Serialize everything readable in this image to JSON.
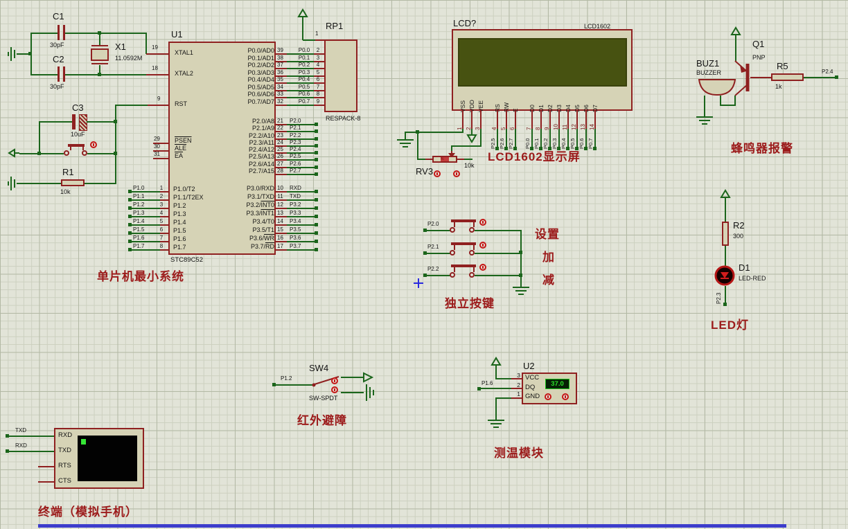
{
  "annotations": {
    "mcu": "单片机最小系统",
    "lcd": "LCD1602显示屏",
    "buzzer": "蜂鸣器报警",
    "keys_title": "独立按键",
    "key_set": "设置",
    "key_add": "加",
    "key_sub": "减",
    "led": "LED灯",
    "infrared": "红外避障",
    "temp": "测温模块",
    "terminal": "终端（模拟手机）"
  },
  "parts": {
    "c1": {
      "ref": "C1",
      "value": "30pF"
    },
    "c2": {
      "ref": "C2",
      "value": "30pF"
    },
    "x1": {
      "ref": "X1",
      "value": "11.0592M"
    },
    "c3": {
      "ref": "C3",
      "value": "10uF"
    },
    "r1": {
      "ref": "R1",
      "value": "10k"
    },
    "rv3": {
      "ref": "RV3",
      "value": "10k"
    },
    "rp1": {
      "ref": "RP1",
      "part": "RESPACK-8",
      "pin1_num": "1"
    },
    "r5": {
      "ref": "R5",
      "value": "1k"
    },
    "r2": {
      "ref": "R2",
      "value": "300"
    },
    "d1": {
      "ref": "D1",
      "part": "LED-RED"
    },
    "q1": {
      "ref": "Q1",
      "part": "PNP"
    },
    "buz1": {
      "ref": "BUZ1",
      "part": "BUZZER"
    },
    "sw4": {
      "ref": "SW4",
      "part": "SW-SPDT"
    },
    "u2": {
      "ref": "U2",
      "display_value": "37.0"
    },
    "lcd": {
      "ref": "LCD?",
      "part": "LCD1602"
    }
  },
  "nets": {
    "buzzer": "P2.4",
    "led": "P2.3",
    "sw": "P1.2",
    "temp": "P1.6"
  },
  "u1": {
    "ref": "U1",
    "part": "STC89C52",
    "xtal1": {
      "num": "19",
      "name": "XTAL1"
    },
    "xtal2": {
      "num": "18",
      "name": "XTAL2"
    },
    "rst": {
      "num": "9",
      "name": "RST"
    },
    "ctrl_pins": [
      {
        "num": "29",
        "pre": "",
        "over": "PSEN"
      },
      {
        "num": "30",
        "pre": "",
        "over": "ALE"
      },
      {
        "num": "31",
        "pre": "",
        "over": "EA"
      }
    ],
    "p0_pins": [
      {
        "num": "39",
        "pre": "P0.0/AD0",
        "over": "",
        "net": "P0.0",
        "rp_num": "2"
      },
      {
        "num": "38",
        "pre": "P0.1/AD1",
        "over": "",
        "net": "P0.1",
        "rp_num": "3"
      },
      {
        "num": "37",
        "pre": "P0.2/AD2",
        "over": "",
        "net": "P0.2",
        "rp_num": "4"
      },
      {
        "num": "36",
        "pre": "P0.3/AD3",
        "over": "",
        "net": "P0.3",
        "rp_num": "5"
      },
      {
        "num": "35",
        "pre": "P0.4/AD4",
        "over": "",
        "net": "P0.4",
        "rp_num": "6"
      },
      {
        "num": "34",
        "pre": "P0.5/AD5",
        "over": "",
        "net": "P0.5",
        "rp_num": "7"
      },
      {
        "num": "33",
        "pre": "P0.6/AD6",
        "over": "",
        "net": "P0.6",
        "rp_num": "8"
      },
      {
        "num": "32",
        "pre": "P0.7/AD7",
        "over": "",
        "net": "P0.7",
        "rp_num": "9"
      }
    ],
    "p2_pins": [
      {
        "num": "21",
        "pre": "P2.0/A8",
        "over": "",
        "net": "P2.0"
      },
      {
        "num": "22",
        "pre": "P2.1/A9",
        "over": "",
        "net": "P2.1"
      },
      {
        "num": "23",
        "pre": "P2.2/A10",
        "over": "",
        "net": "P2.2"
      },
      {
        "num": "24",
        "pre": "P2.3/A11",
        "over": "",
        "net": "P2.3"
      },
      {
        "num": "25",
        "pre": "P2.4/A12",
        "over": "",
        "net": "P2.4"
      },
      {
        "num": "26",
        "pre": "P2.5/A13",
        "over": "",
        "net": "P2.5"
      },
      {
        "num": "27",
        "pre": "P2.6/A14",
        "over": "",
        "net": "P2.6"
      },
      {
        "num": "28",
        "pre": "P2.7/A15",
        "over": "",
        "net": "P2.7"
      }
    ],
    "p3_pins": [
      {
        "num": "10",
        "pre": "P3.0/RXD",
        "over": "",
        "net": "RXD"
      },
      {
        "num": "11",
        "pre": "P3.1/TXD",
        "over": "",
        "net": "TXD"
      },
      {
        "num": "12",
        "pre": "P3.2/",
        "over": "INT0",
        "net": "P3.2"
      },
      {
        "num": "13",
        "pre": "P3.3/",
        "over": "INT1",
        "net": "P3.3"
      },
      {
        "num": "14",
        "pre": "P3.4/T0",
        "over": "",
        "net": "P3.4"
      },
      {
        "num": "15",
        "pre": "P3.5/T1",
        "over": "",
        "net": "P3.5"
      },
      {
        "num": "16",
        "pre": "P3.6/",
        "over": "WR",
        "net": "P3.6"
      },
      {
        "num": "17",
        "pre": "P3.7/",
        "over": "RD",
        "net": "P3.7"
      }
    ],
    "p1_pins": [
      {
        "num": "1",
        "name": "P1.0/T2",
        "net": "P1.0"
      },
      {
        "num": "2",
        "name": "P1.1/T2EX",
        "net": "P1.1"
      },
      {
        "num": "3",
        "name": "P1.2",
        "net": "P1.2"
      },
      {
        "num": "4",
        "name": "P1.3",
        "net": "P1.3"
      },
      {
        "num": "5",
        "name": "P1.4",
        "net": "P1.4"
      },
      {
        "num": "6",
        "name": "P1.5",
        "net": "P1.5"
      },
      {
        "num": "7",
        "name": "P1.6",
        "net": "P1.6"
      },
      {
        "num": "8",
        "name": "P1.7",
        "net": "P1.7"
      }
    ]
  },
  "lcd_pins": {
    "power": [
      {
        "name": "VSS",
        "num": "1",
        "net": ""
      },
      {
        "name": "VDD",
        "num": "2",
        "net": ""
      },
      {
        "name": "VEE",
        "num": "3",
        "net": ""
      }
    ],
    "ctrl": [
      {
        "name": "RS",
        "num": "4",
        "net": "P2.5"
      },
      {
        "name": "RW",
        "num": "5",
        "net": "P2.6"
      },
      {
        "name": "E",
        "num": "6",
        "net": "P2.7"
      }
    ],
    "data": [
      {
        "name": "D0",
        "num": "7",
        "net": "P0.0"
      },
      {
        "name": "D1",
        "num": "8",
        "net": "P0.1"
      },
      {
        "name": "D2",
        "num": "9",
        "net": "P0.2"
      },
      {
        "name": "D3",
        "num": "10",
        "net": "P0.3"
      },
      {
        "name": "D4",
        "num": "11",
        "net": "P0.4"
      },
      {
        "name": "D5",
        "num": "12",
        "net": "P0.5"
      },
      {
        "name": "D6",
        "num": "13",
        "net": "P0.6"
      },
      {
        "name": "D7",
        "num": "14",
        "net": "P0.7"
      }
    ]
  },
  "keys": [
    {
      "net": "P2.0"
    },
    {
      "net": "P2.1"
    },
    {
      "net": "P2.2"
    }
  ],
  "u2_pins": [
    {
      "num": "3",
      "name": "VCC"
    },
    {
      "num": "2",
      "name": "DQ"
    },
    {
      "num": "1",
      "name": "GND"
    }
  ],
  "terminal_pins": [
    {
      "name": "RXD"
    },
    {
      "name": "TXD"
    },
    {
      "name": "RTS"
    },
    {
      "name": "CTS"
    }
  ],
  "terminal_nets": {
    "top": "TXD",
    "bottom": "RXD"
  }
}
